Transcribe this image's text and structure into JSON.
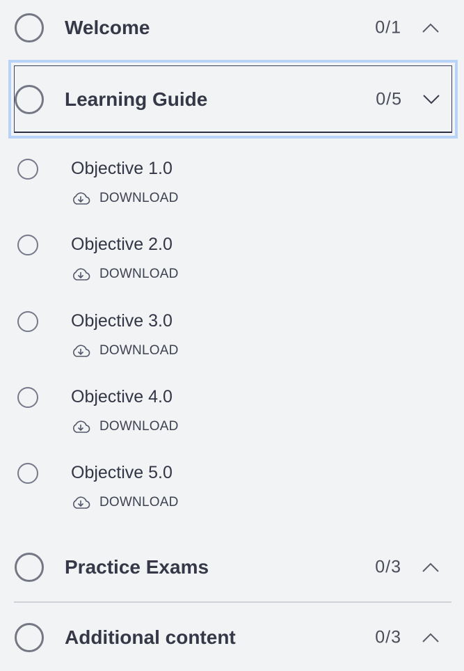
{
  "sections": [
    {
      "title": "Welcome",
      "count": "0/1",
      "chevron": "chevron-up-icon"
    },
    {
      "title": "Learning Guide",
      "count": "0/5",
      "chevron": "chevron-down-icon"
    },
    {
      "title": "Practice Exams",
      "count": "0/3",
      "chevron": "chevron-up-icon"
    },
    {
      "title": "Additional content",
      "count": "0/3",
      "chevron": "chevron-up-icon"
    }
  ],
  "items": [
    {
      "title": "Objective 1.0",
      "action": "DOWNLOAD"
    },
    {
      "title": "Objective 2.0",
      "action": "DOWNLOAD"
    },
    {
      "title": "Objective 3.0",
      "action": "DOWNLOAD"
    },
    {
      "title": "Objective 4.0",
      "action": "DOWNLOAD"
    },
    {
      "title": "Objective 5.0",
      "action": "DOWNLOAD"
    }
  ],
  "colors": {
    "focus_ring": "#b9d2f7",
    "background": "#f1f3f5",
    "text": "#363847"
  }
}
